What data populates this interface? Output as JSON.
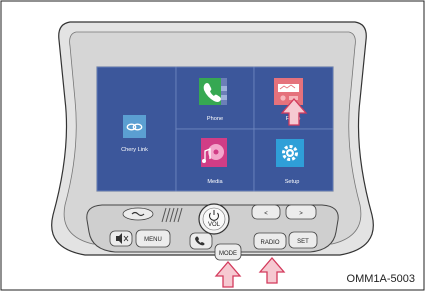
{
  "screen": {
    "tiles": [
      {
        "label": "Chery Link",
        "icon": "chery-link-icon"
      },
      {
        "label": "Phone",
        "icon": "phone-icon"
      },
      {
        "label": "Radio",
        "icon": "radio-icon"
      },
      {
        "label": "Media",
        "icon": "media-icon"
      },
      {
        "label": "Setup",
        "icon": "gear-icon"
      }
    ]
  },
  "controls": {
    "vol": "VOL",
    "menu": "MENU",
    "mode": "MODE",
    "radio": "RADIO",
    "set": "SET",
    "prev": "<",
    "next": ">"
  },
  "caption": "OMM1A-5003",
  "colors": {
    "screen_bg": "#3c579b",
    "tile_border": "#6f87c0",
    "phone": "#36a852",
    "radio": "#e5727c",
    "media": "#d13d86",
    "setup": "#2f9fd8",
    "arrow_fill": "#f6c9d1",
    "arrow_stroke": "#d33a5c"
  }
}
